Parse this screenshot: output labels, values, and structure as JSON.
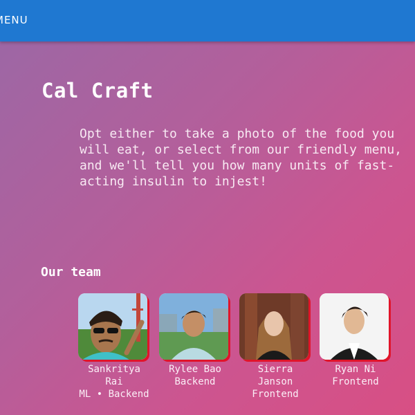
{
  "nav": {
    "menu_label": "MENU"
  },
  "hero": {
    "title": "Cal Craft",
    "description": "Opt either to take a photo of the food you will eat, or select from our friendly menu, and we'll tell you how many units of fast-acting insulin to injest!"
  },
  "team": {
    "heading": "Our team",
    "members": [
      {
        "name": "Sankritya Rai",
        "role": "ML • Backend"
      },
      {
        "name": "Rylee Bao",
        "role": "Backend"
      },
      {
        "name": "Sierra Janson",
        "role": "Frontend"
      },
      {
        "name": "Ryan Ni",
        "role": "Frontend"
      }
    ]
  },
  "colors": {
    "topbar": "#1f78d1",
    "photo_shadow": "#e0142a",
    "gradient_start": "#9a68a6",
    "gradient_end": "#d84f84"
  }
}
